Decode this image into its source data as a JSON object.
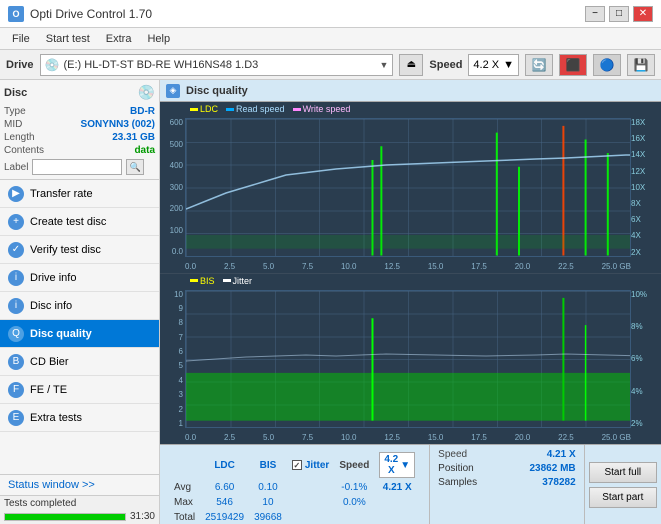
{
  "titlebar": {
    "title": "Opti Drive Control 1.70",
    "min_btn": "−",
    "max_btn": "□",
    "close_btn": "✕"
  },
  "menubar": {
    "items": [
      "File",
      "Start test",
      "Extra",
      "Help"
    ]
  },
  "drivebar": {
    "label": "Drive",
    "drive_name": "(E:)  HL-DT-ST BD-RE  WH16NS48 1.D3",
    "speed_label": "Speed",
    "speed_value": "4.2 X"
  },
  "disc": {
    "title": "Disc",
    "type_label": "Type",
    "type_value": "BD-R",
    "mid_label": "MID",
    "mid_value": "SONYNN3 (002)",
    "length_label": "Length",
    "length_value": "23.31 GB",
    "contents_label": "Contents",
    "contents_value": "data",
    "label_label": "Label",
    "label_value": ""
  },
  "sidebar": {
    "items": [
      {
        "id": "transfer-rate",
        "label": "Transfer rate",
        "icon": "▶"
      },
      {
        "id": "create-test-disc",
        "label": "Create test disc",
        "icon": "+"
      },
      {
        "id": "verify-test-disc",
        "label": "Verify test disc",
        "icon": "✓"
      },
      {
        "id": "drive-info",
        "label": "Drive info",
        "icon": "i"
      },
      {
        "id": "disc-info",
        "label": "Disc info",
        "icon": "i"
      },
      {
        "id": "disc-quality",
        "label": "Disc quality",
        "icon": "Q",
        "active": true
      },
      {
        "id": "cd-bier",
        "label": "CD Bier",
        "icon": "B"
      },
      {
        "id": "fe-te",
        "label": "FE / TE",
        "icon": "F"
      },
      {
        "id": "extra-tests",
        "label": "Extra tests",
        "icon": "E"
      }
    ]
  },
  "status_window_btn": "Status window >>",
  "status": {
    "text": "Tests completed",
    "progress": 100,
    "time": "31:30"
  },
  "disc_quality": {
    "title": "Disc quality",
    "chart1": {
      "legend": [
        {
          "label": "LDC",
          "color": "#ffff00"
        },
        {
          "label": "Read speed",
          "color": "#00aaff"
        },
        {
          "label": "Write speed",
          "color": "#ff88ff"
        }
      ],
      "y_left_labels": [
        "600",
        "500",
        "400",
        "300",
        "200",
        "100",
        "0.0"
      ],
      "y_right_labels": [
        "18X",
        "16X",
        "14X",
        "12X",
        "10X",
        "8X",
        "6X",
        "4X",
        "2X"
      ],
      "x_labels": [
        "0.0",
        "2.5",
        "5.0",
        "7.5",
        "10.0",
        "12.5",
        "15.0",
        "17.5",
        "20.0",
        "22.5",
        "25.0 GB"
      ]
    },
    "chart2": {
      "legend": [
        {
          "label": "BIS",
          "color": "#ffff00"
        },
        {
          "label": "Jitter",
          "color": "#ffffff"
        }
      ],
      "y_left_labels": [
        "10",
        "9",
        "8",
        "7",
        "6",
        "5",
        "4",
        "3",
        "2",
        "1"
      ],
      "y_right_labels": [
        "10%",
        "8%",
        "6%",
        "4%",
        "2%"
      ],
      "x_labels": [
        "0.0",
        "2.5",
        "5.0",
        "7.5",
        "10.0",
        "12.5",
        "15.0",
        "17.5",
        "20.0",
        "22.5",
        "25.0 GB"
      ]
    }
  },
  "stats": {
    "columns": [
      "",
      "LDC",
      "BIS",
      "",
      "Jitter",
      "Speed",
      ""
    ],
    "rows": [
      {
        "label": "Avg",
        "ldc": "6.60",
        "bis": "0.10",
        "jitter": "-0.1%",
        "speed": "4.21 X"
      },
      {
        "label": "Max",
        "ldc": "546",
        "bis": "10",
        "jitter": "0.0%",
        "position": "23862 MB"
      },
      {
        "label": "Total",
        "ldc": "2519429",
        "bis": "39668",
        "samples": "378282"
      }
    ],
    "jitter_checked": true,
    "jitter_label": "Jitter",
    "speed_display": "4.2 X",
    "position_label": "Position",
    "position_value": "23862 MB",
    "samples_label": "Samples",
    "samples_value": "378282",
    "start_full_btn": "Start full",
    "start_part_btn": "Start part"
  }
}
